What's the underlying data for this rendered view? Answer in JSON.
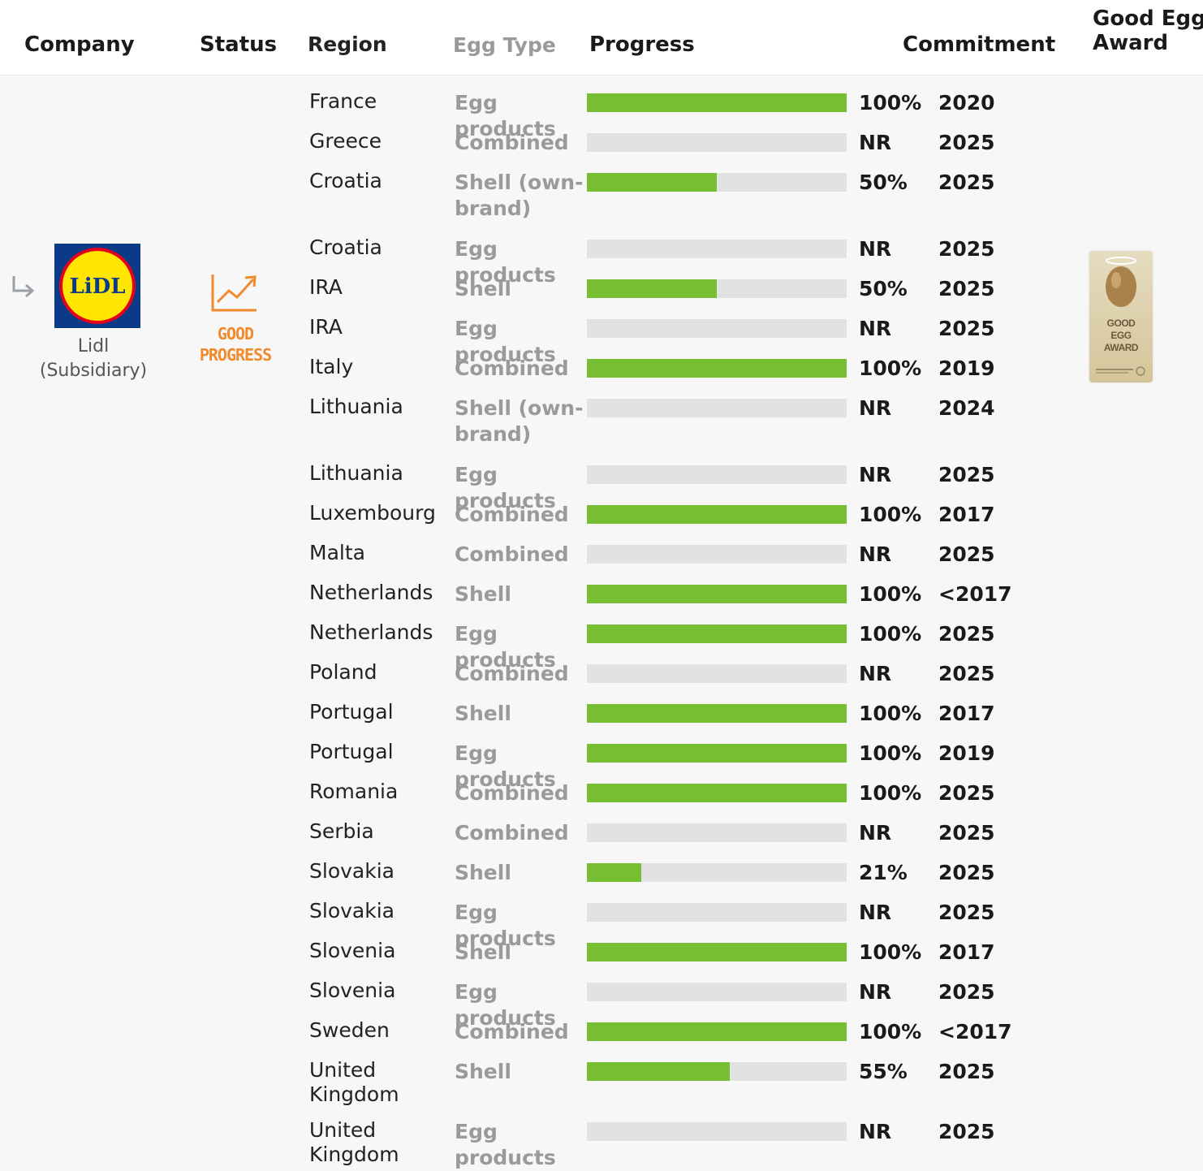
{
  "header": {
    "company": "Company",
    "status": "Status",
    "region": "Region",
    "egg_type": "Egg Type",
    "progress": "Progress",
    "commitment": "Commitment",
    "award": "Good Egg Award"
  },
  "company": {
    "logo_text": "LiDL",
    "name": "Lidl",
    "subtitle": "(Subsidiary)",
    "status_line1": "GOOD",
    "status_line2": "PROGRESS",
    "award_line1": "GOOD",
    "award_line2": "EGG",
    "award_line3": "AWARD",
    "colors": {
      "status": "#f08a2c",
      "bar_fill": "#78be32",
      "bar_track": "#e2e2e2",
      "logo_blue": "#0a3a88",
      "logo_yellow": "#ffe600",
      "logo_red": "#e2001a"
    }
  },
  "rows": [
    {
      "region": "France",
      "egg_type": "Egg products",
      "progress": 1.0,
      "pct": "100%",
      "year": "2020"
    },
    {
      "region": "Greece",
      "egg_type": "Combined",
      "progress": 0,
      "pct": "NR",
      "year": "2025"
    },
    {
      "region": "Croatia",
      "egg_type": "Shell (own-brand)",
      "progress": 0.5,
      "pct": "50%",
      "year": "2025"
    },
    {
      "region": "Croatia",
      "egg_type": "Egg products",
      "progress": 0,
      "pct": "NR",
      "year": "2025"
    },
    {
      "region": "IRA",
      "egg_type": "Shell",
      "progress": 0.5,
      "pct": "50%",
      "year": "2025"
    },
    {
      "region": "IRA",
      "egg_type": "Egg products",
      "progress": 0,
      "pct": "NR",
      "year": "2025"
    },
    {
      "region": "Italy",
      "egg_type": "Combined",
      "progress": 1.0,
      "pct": "100%",
      "year": "2019"
    },
    {
      "region": "Lithuania",
      "egg_type": "Shell (own-brand)",
      "progress": 0,
      "pct": "NR",
      "year": "2024"
    },
    {
      "region": "Lithuania",
      "egg_type": "Egg products",
      "progress": 0,
      "pct": "NR",
      "year": "2025"
    },
    {
      "region": "Luxembourg",
      "egg_type": "Combined",
      "progress": 1.0,
      "pct": "100%",
      "year": "2017"
    },
    {
      "region": "Malta",
      "egg_type": "Combined",
      "progress": 0,
      "pct": "NR",
      "year": "2025"
    },
    {
      "region": "Netherlands",
      "egg_type": "Shell",
      "progress": 1.0,
      "pct": "100%",
      "year": "<2017"
    },
    {
      "region": "Netherlands",
      "egg_type": "Egg products",
      "progress": 1.0,
      "pct": "100%",
      "year": "2025"
    },
    {
      "region": "Poland",
      "egg_type": "Combined",
      "progress": 0,
      "pct": "NR",
      "year": "2025"
    },
    {
      "region": "Portugal",
      "egg_type": "Shell",
      "progress": 1.0,
      "pct": "100%",
      "year": "2017"
    },
    {
      "region": "Portugal",
      "egg_type": "Egg products",
      "progress": 1.0,
      "pct": "100%",
      "year": "2019"
    },
    {
      "region": "Romania",
      "egg_type": "Combined",
      "progress": 1.0,
      "pct": "100%",
      "year": "2025"
    },
    {
      "region": "Serbia",
      "egg_type": "Combined",
      "progress": 0,
      "pct": "NR",
      "year": "2025"
    },
    {
      "region": "Slovakia",
      "egg_type": "Shell",
      "progress": 0.21,
      "pct": "21%",
      "year": "2025"
    },
    {
      "region": "Slovakia",
      "egg_type": "Egg products",
      "progress": 0,
      "pct": "NR",
      "year": "2025"
    },
    {
      "region": "Slovenia",
      "egg_type": "Shell",
      "progress": 1.0,
      "pct": "100%",
      "year": "2017"
    },
    {
      "region": "Slovenia",
      "egg_type": "Egg products",
      "progress": 0,
      "pct": "NR",
      "year": "2025"
    },
    {
      "region": "Sweden",
      "egg_type": "Combined",
      "progress": 1.0,
      "pct": "100%",
      "year": "<2017"
    },
    {
      "region": "United Kingdom",
      "egg_type": "Shell",
      "progress": 0.55,
      "pct": "55%",
      "year": "2025"
    },
    {
      "region": "United Kingdom",
      "egg_type": "Egg products",
      "progress": 0,
      "pct": "NR",
      "year": "2025"
    }
  ]
}
